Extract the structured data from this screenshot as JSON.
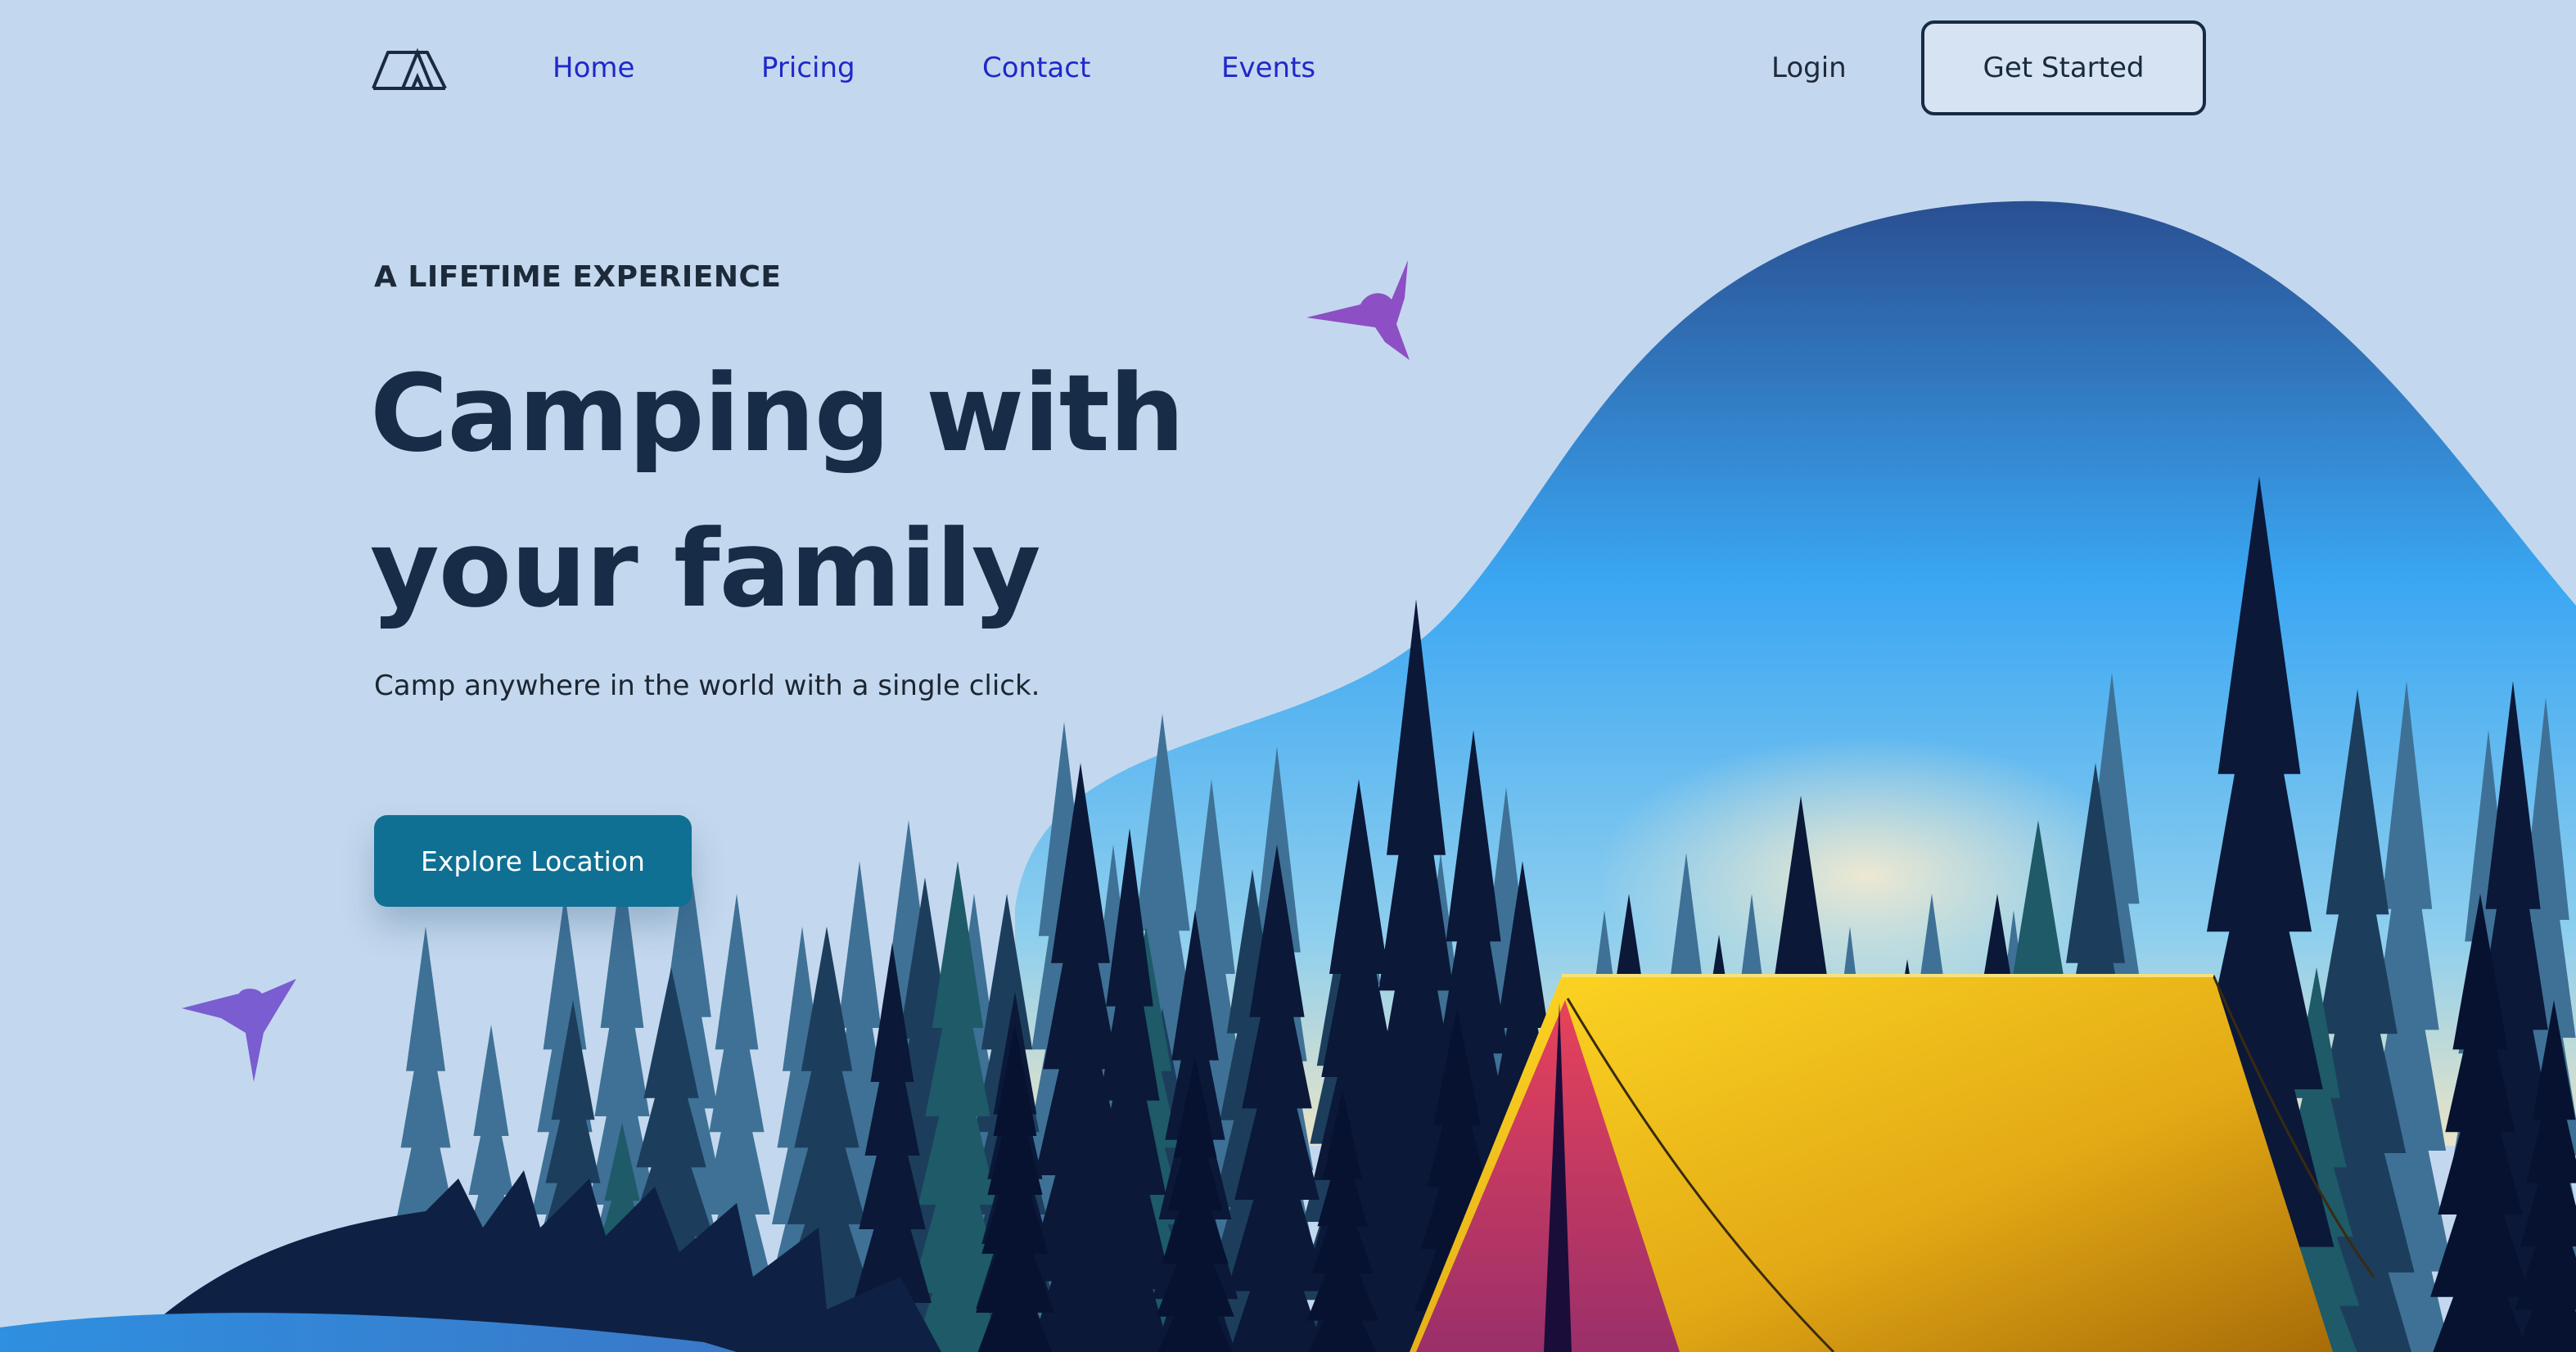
{
  "nav": {
    "links": [
      {
        "label": "Home"
      },
      {
        "label": "Pricing"
      },
      {
        "label": "Contact"
      },
      {
        "label": "Events"
      }
    ],
    "login_label": "Login",
    "cta_label": "Get Started"
  },
  "hero": {
    "eyebrow": "A LIFETIME EXPERIENCE",
    "title_line1": "Camping with",
    "title_line2": "your family",
    "subtitle": "Camp anywhere in the world with a single click.",
    "button_label": "Explore Location"
  },
  "icons": {
    "logo": "tent-logo-icon",
    "bird_1": "hummingbird-icon",
    "bird_2": "hummingbird-icon"
  },
  "colors": {
    "page_background": "#c3d8ee",
    "nav_link": "#1f28c9",
    "headline": "#172d47",
    "primary_button": "#0f7093",
    "tent_yellow": "#f3c21c",
    "tent_red": "#e5405a",
    "hummingbird_purple": "#8d4fc4"
  }
}
